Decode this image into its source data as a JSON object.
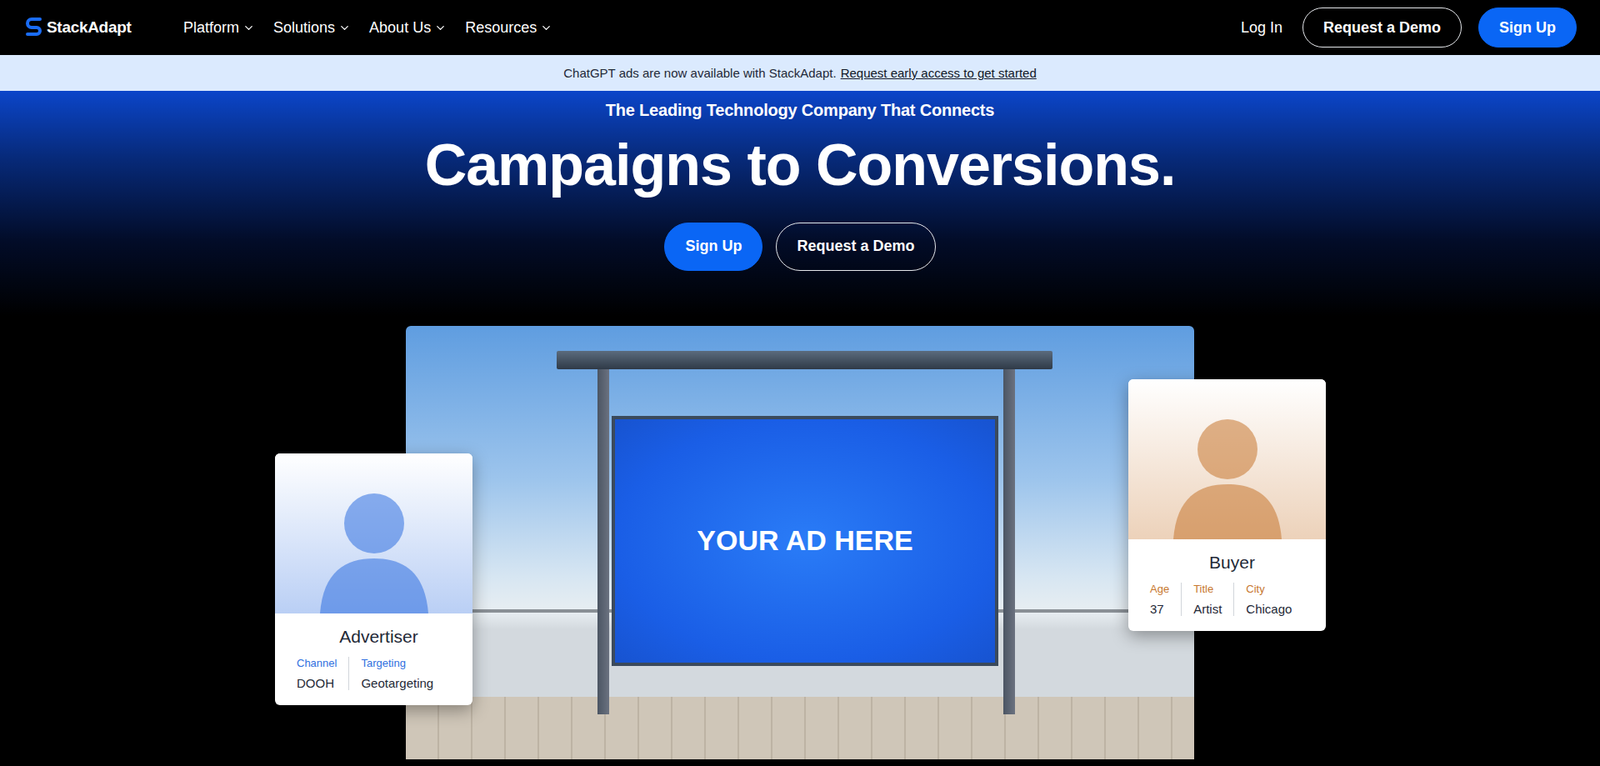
{
  "nav": {
    "logo": "StackAdapt",
    "items": [
      {
        "label": "Platform"
      },
      {
        "label": "Solutions"
      },
      {
        "label": "About Us"
      },
      {
        "label": "Resources"
      }
    ],
    "login": "Log In",
    "demo": "Request a Demo",
    "signup": "Sign Up"
  },
  "banner": {
    "text": "ChatGPT ads are now available with StackAdapt.",
    "link": "Request early access to get started"
  },
  "hero": {
    "eyebrow": "The Leading Technology Company That Connects",
    "title": "Campaigns to Conversions.",
    "buttons": [
      {
        "label": "Sign Up",
        "kind": "primary"
      },
      {
        "label": "Request a Demo",
        "kind": "outline"
      }
    ]
  },
  "showcase": {
    "ad_text": "YOUR AD HERE",
    "cards": [
      {
        "title": "Advertiser",
        "color": "#2f6fe0",
        "fields": [
          {
            "label": "Channel",
            "value": "DOOH"
          },
          {
            "label": "Targeting",
            "value": "Geotargeting"
          }
        ]
      },
      {
        "title": "Buyer",
        "color": "#c7772f",
        "fields": [
          {
            "label": "Age",
            "value": "37"
          },
          {
            "label": "Title",
            "value": "Artist"
          },
          {
            "label": "City",
            "value": "Chicago"
          }
        ]
      }
    ]
  }
}
